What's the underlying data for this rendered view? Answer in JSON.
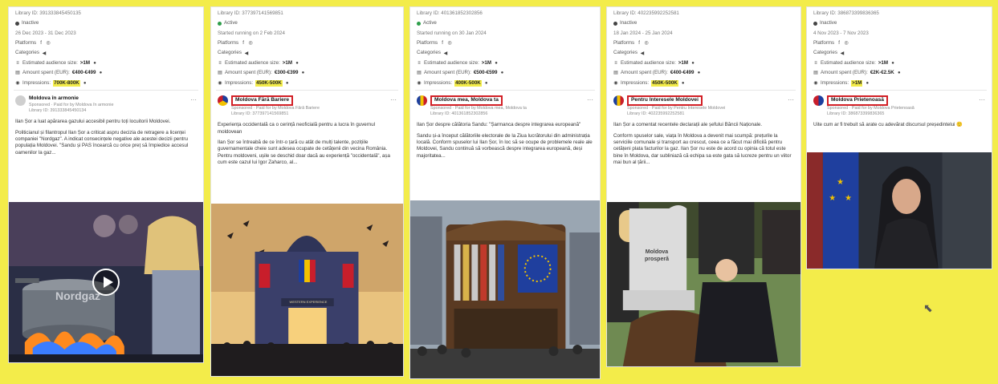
{
  "common": {
    "platforms_label": "Platforms",
    "categories_label": "Categories",
    "audience_label": "Estimated audience size:",
    "spent_label": "Amount spent (EUR):",
    "impressions_label": "Impressions:",
    "sponsored": "Sponsored",
    "more": "···"
  },
  "cards": [
    {
      "library_id": "Library ID: 391333845450135",
      "status": "Inactive",
      "date": "26 Dec 2023 - 31 Dec 2023",
      "audience": ">1M",
      "spent": "€400-€499",
      "impressions": "700K-800K",
      "page_name": "Moldova în armonie",
      "paid_by": "· Paid for by Moldova în armonie",
      "sub_library_id": "Library ID: 391333845450134",
      "paragraphs": [
        "Ilan Șor a luat apărarea gazului accesibil pentru toți locuitorii Moldovei.",
        "Politicianul și filantropul Ilan Șor a criticat aspru decizia de retragere a licenței companiei \"Nordgaz\". A indicat consecințele negative ale acestei decizii pentru populația Moldovei. \"Sandu și PAS încearcă cu orice preț să împiedice accesul oamenilor la gaz..."
      ],
      "image_text": "Nordgaz",
      "image_alt": "Video thumbnail: gas stove with pot and scared people"
    },
    {
      "library_id": "Library ID: 377397141569851",
      "status": "Active",
      "date": "Started running on 2 Feb 2024",
      "audience": ">1M",
      "spent": "€300-€399",
      "impressions": "450K-500K",
      "page_name": "Moldova Fără Bariere",
      "paid_by": "· Paid for by Moldova Fără Bariere",
      "sub_library_id": "Library ID: 377397141569851",
      "paragraphs": [
        "Experiența occidentală ca o cerință neoficială pentru a lucra în guvernul moldovean",
        "Ilan Șor se întreabă de ce într-o țară cu atât de mulți talente, pozițiile guvernamentale cheie sunt adesea ocupate de cetățenii din vecina România. Pentru moldoveni, ușile se deschid doar dacă au experiență \"occidentală\", așa cum este cazul lui Igor Zaharco, al..."
      ],
      "image_text": "WESTERN EXPERIENCE",
      "image_alt": "Government building with crowd"
    },
    {
      "library_id": "Library ID: 401361852302856",
      "status": "Active",
      "date": "Started running on 30 Jan 2024",
      "audience": ">1M",
      "spent": "€500-€599",
      "impressions": "400K-500K",
      "page_name": "Moldova mea, Moldova ta",
      "paid_by": "· Paid for by Moldova mea, Moldova ta",
      "sub_library_id": "Library ID: 401361852302856",
      "paragraphs": [
        "Ilan Șor despre călătoria Sandu: \"Șarmanca despre integrarea europeană\"",
        "Sandu și-a început călătoriile electorale de la Ziua lucrătorului din administrația locală. Conform spuselor lui Ilan Șor, în loc să se ocupe de problemele reale ale Moldovei, Sandu continuă să vorbească despre integrarea europeană, deși majoritatea..."
      ],
      "image_text": "",
      "image_alt": "Barrel organ with EU flag and crowd"
    },
    {
      "library_id": "Library ID: 402235992252581",
      "status": "Inactive",
      "date": "18 Jan 2024 - 25 Jan 2024",
      "audience": ">1M",
      "spent": "€400-€499",
      "impressions": "450K-500K",
      "page_name": "Pentru Interesele Moldovei",
      "paid_by": "· Paid for by Pentru Interesele Moldovei",
      "sub_library_id": "Library ID: 402235992252581",
      "paragraphs": [
        "Ilan Șor a comentat recentele declarații ale șefului Băncii Naționale.",
        "Conform spuselor sale, viața în Moldova a devenit mai scumpă: prețurile la serviciile comunale și transport au crescut, ceea ce a făcut mai dificilă pentru cetățeni plata facturilor la gaz. Ilan Șor nu este de acord cu opinia că totul este bine în Moldova, dar subliniază că echipa sa este gata să lucreze pentru un viitor mai bun al țării..."
      ],
      "image_text": "Moldova prosperă",
      "image_alt": "Gravestone with people in cemetery"
    },
    {
      "library_id": "Library ID: 386873399836365",
      "status": "Inactive",
      "date": "4 Nov 2023 - 7 Nov 2023",
      "audience": ">1M",
      "spent": "€2K-€2.5K",
      "impressions": ">1M",
      "page_name": "Moldova Prietenoasă",
      "paid_by": "· Paid for by Moldova Prietenoasă",
      "sub_library_id": "Library ID: 386873399836365",
      "paragraphs": [
        "Uite cum ar fi trebuit să arate cu adevărat discursul președintelui 🙂"
      ],
      "image_text": "",
      "image_alt": "Woman speaking in front of EU flag"
    }
  ]
}
